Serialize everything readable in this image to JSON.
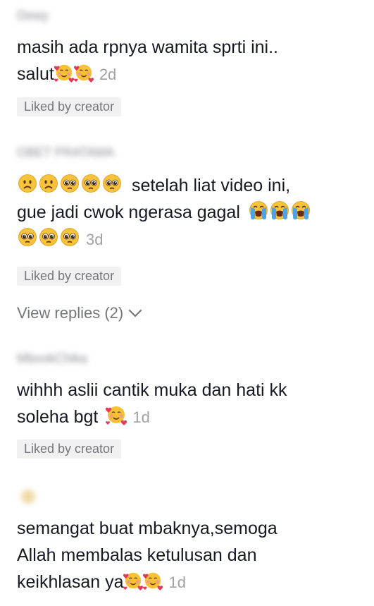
{
  "comments": [
    {
      "username": "Dewy",
      "line1": "masih ada rpnya wamita sprti ini..",
      "line2": "salut",
      "line2_emojis": [
        "smiling-face-with-hearts",
        "smiling-face-with-hearts"
      ],
      "age": "2d",
      "badge": "Liked by creator"
    },
    {
      "username": "OBET PRATAMA",
      "line1_emojis": [
        "frowning-face",
        "frowning-face",
        "pleading-face",
        "pleading-face",
        "pleading-face"
      ],
      "line1": "setelah liat video ini,",
      "line2": "gue jadi cwok ngerasa gagal",
      "line2_emojis": [
        "loudly-crying-face",
        "loudly-crying-face",
        "loudly-crying-face"
      ],
      "line3_emojis": [
        "pleading-face",
        "pleading-face",
        "pleading-face"
      ],
      "age": "3d",
      "badge": "Liked by creator",
      "view_replies": "View replies (2)"
    },
    {
      "username": "MbookChika",
      "line1": "wihhh aslii cantik muka dan hati kk",
      "line2": "soleha bgt",
      "line2_emojis": [
        "smiling-face-with-hearts"
      ],
      "age": "1d",
      "badge": "Liked by creator"
    },
    {
      "line1": "semangat buat mbaknya,semoga",
      "line2": "Allah membalas ketulusan dan",
      "line3": "keikhlasan ya",
      "line3_emojis": [
        "smiling-face-with-hearts",
        "smiling-face-with-hearts"
      ],
      "age": "1d"
    }
  ]
}
